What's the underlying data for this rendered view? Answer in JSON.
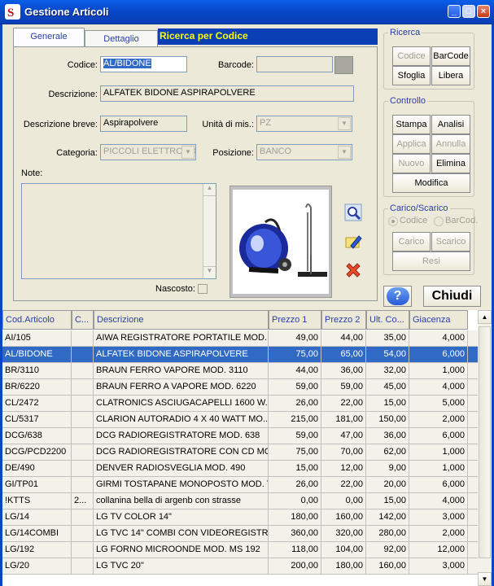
{
  "window": {
    "title": "Gestione Articoli",
    "min": "_",
    "max": "□",
    "close": "×"
  },
  "tabs": {
    "generale": "Generale",
    "dettaglio": "Dettaglio",
    "ricerca": "Ricerca per Codice"
  },
  "form": {
    "codice_label": "Codice:",
    "codice_value": "AL/BIDONE",
    "barcode_label": "Barcode:",
    "barcode_value": "",
    "descrizione_label": "Descrizione:",
    "descrizione_value": "ALFATEK BIDONE ASPIRAPOLVERE",
    "descrizione_breve_label": "Descrizione breve:",
    "descrizione_breve_value": "Aspirapolvere",
    "unita_label": "Unità di mis.:",
    "unita_value": "PZ",
    "categoria_label": "Categoria:",
    "categoria_value": "PICCOLI ELETTRODO",
    "posizione_label": "Posizione:",
    "posizione_value": "BANCO",
    "note_label": "Note:",
    "note_value": "",
    "nascosto_label": "Nascosto:"
  },
  "ricerca": {
    "title": "Ricerca",
    "codice": "Codice",
    "barcode": "BarCode",
    "sfoglia": "Sfoglia",
    "libera": "Libera"
  },
  "controllo": {
    "title": "Controllo",
    "stampa": "Stampa",
    "analisi": "Analisi",
    "applica": "Applica",
    "annulla": "Annulla",
    "nuovo": "Nuovo",
    "elimina": "Elimina",
    "modifica": "Modifica"
  },
  "carico": {
    "title": "Carico/Scarico",
    "opt_codice": "Codice",
    "opt_barcode": "BarCod.",
    "carico": "Carico",
    "scarico": "Scarico",
    "resi": "Resi"
  },
  "chiudi": "Chiudi",
  "help": "?",
  "grid": {
    "columns": [
      "Cod.Articolo",
      "C...",
      "Descrizione",
      "Prezzo 1",
      "Prezzo 2",
      "Ult. Co...",
      "Giacenza"
    ],
    "rows": [
      [
        "AI/105",
        "",
        "AIWA REGISTRATORE PORTATILE MOD. ...",
        "49,00",
        "44,00",
        "35,00",
        "4,000"
      ],
      [
        "AL/BIDONE",
        "",
        "ALFATEK BIDONE ASPIRAPOLVERE",
        "75,00",
        "65,00",
        "54,00",
        "6,000"
      ],
      [
        "BR/3110",
        "",
        "BRAUN FERRO VAPORE MOD. 3110",
        "44,00",
        "36,00",
        "32,00",
        "1,000"
      ],
      [
        "BR/6220",
        "",
        "BRAUN FERRO A VAPORE MOD. 6220",
        "59,00",
        "59,00",
        "45,00",
        "4,000"
      ],
      [
        "CL/2472",
        "",
        "CLATRONICS ASCIUGACAPELLI 1600 W...",
        "26,00",
        "22,00",
        "15,00",
        "5,000"
      ],
      [
        "CL/5317",
        "",
        "CLARION AUTORADIO 4 X 40 WATT MO...",
        "215,00",
        "181,00",
        "150,00",
        "2,000"
      ],
      [
        "DCG/638",
        "",
        "DCG RADIOREGISTRATORE MOD. 638",
        "59,00",
        "47,00",
        "36,00",
        "6,000"
      ],
      [
        "DCG/PCD2200",
        "",
        "DCG RADIOREGISTRATORE CON CD MO...",
        "75,00",
        "70,00",
        "62,00",
        "1,000"
      ],
      [
        "DE/490",
        "",
        "DENVER RADIOSVEGLIA MOD. 490",
        "15,00",
        "12,00",
        "9,00",
        "1,000"
      ],
      [
        "GI/TP01",
        "",
        "GIRMI TOSTAPANE MONOPOSTO MOD. T...",
        "26,00",
        "22,00",
        "20,00",
        "6,000"
      ],
      [
        "!KTTS",
        "2...",
        "collanina bella di argenb con strasse",
        "0,00",
        "0,00",
        "15,00",
        "4,000"
      ],
      [
        "LG/14",
        "",
        "LG TV COLOR 14\"",
        "180,00",
        "160,00",
        "142,00",
        "3,000"
      ],
      [
        "LG/14COMBI",
        "",
        "LG TVC 14\" COMBI CON VIDEOREGISTR...",
        "360,00",
        "320,00",
        "280,00",
        "2,000"
      ],
      [
        "LG/192",
        "",
        "LG FORNO MICROONDE MOD. MS 192",
        "118,00",
        "104,00",
        "92,00",
        "12,000"
      ],
      [
        "LG/20",
        "",
        "LG TVC 20\"",
        "200,00",
        "180,00",
        "160,00",
        "3,000"
      ]
    ]
  },
  "colors": {
    "title_bar": "#0846c6",
    "selection": "#316ac5",
    "banner_text": "#ffff00",
    "link_blue": "#2a3ea7"
  }
}
